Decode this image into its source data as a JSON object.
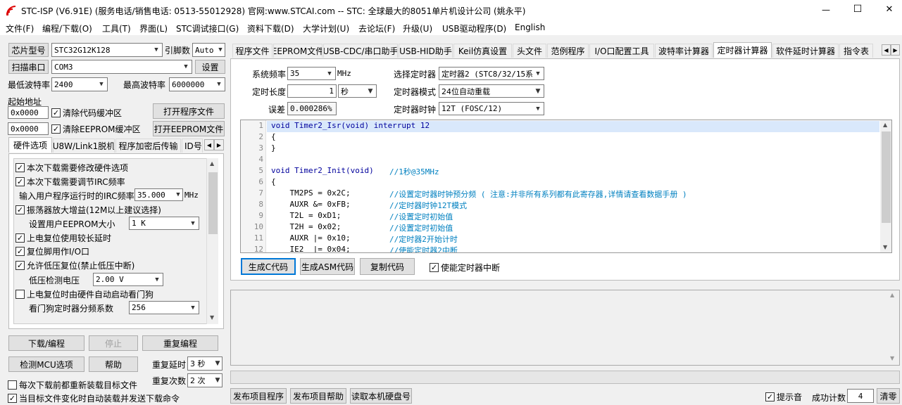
{
  "window": {
    "title": "STC-ISP (V6.91E) (服务电话/销售电话: 0513-55012928) 官网:www.STCAI.com  -- STC: 全球最大的8051单片机设计公司 (姚永平)",
    "minimize": "—",
    "maximize": "☐",
    "close": "✕"
  },
  "menu": [
    "文件(F)",
    "编程/下载(O)",
    "工具(T)",
    "界面(L)",
    "STC调试接口(G)",
    "资料下载(D)",
    "大学计划(U)",
    "去论坛(F)",
    "升级(U)",
    "USB驱动程序(D)",
    "English"
  ],
  "left": {
    "chip_label": "芯片型号",
    "chip_value": "STC32G12K128",
    "pin_label": "引脚数",
    "pin_value": "Auto",
    "scan_label": "扫描串口",
    "com_value": "COM3",
    "settings_label": "设置",
    "min_baud_label": "最低波特率",
    "min_baud_value": "2400",
    "max_baud_label": "最高波特率",
    "max_baud_value": "6000000",
    "start_addr_label": "起始地址",
    "addr1": "0x0000",
    "clear_code_label": "清除代码缓冲区",
    "open_prog_label": "打开程序文件",
    "addr2": "0x0000",
    "clear_eeprom_label": "清除EEPROM缓冲区",
    "open_eeprom_label": "打开EEPROM文件",
    "tabs": [
      "硬件选项",
      "U8W/Link1脱机",
      "程序加密后传输",
      "ID号"
    ],
    "options": {
      "opt1": "本次下载需要修改硬件选项",
      "opt2": "本次下载需要调节IRC频率",
      "irc_label": "输入用户程序运行时的IRC频率",
      "irc_value": "35.000",
      "irc_unit": "MHz",
      "opt3": "振荡器放大增益(12M以上建议选择)",
      "eeprom_size_label": "设置用户EEPROM大小",
      "eeprom_size_value": "1    K",
      "opt4": "上电复位使用较长延时",
      "opt5": "复位脚用作I/O口",
      "opt6": "允许低压复位(禁止低压中断)",
      "lv_label": "低压检测电压",
      "lv_value": "2.00 V",
      "opt7": "上电复位时由硬件自动启动看门狗",
      "wdt_label": "看门狗定时器分频系数",
      "wdt_value": "256"
    },
    "download_btn": "下载/编程",
    "stop_btn": "停止",
    "reprogram_btn": "重复编程",
    "check_mcu_btn": "检测MCU选项",
    "help_btn": "帮助",
    "retry_delay_label": "重复延时",
    "retry_delay_value": "3 秒",
    "retry_count_label": "重复次数",
    "retry_count_value": "2 次",
    "reload_label": "每次下载前都重新装载目标文件",
    "auto_send_label": "当目标文件变化时自动装载并发送下载命令"
  },
  "right_tabs": [
    "程序文件",
    "EEPROM文件",
    "USB-CDC/串口助手",
    "USB-HID助手",
    "Keil仿真设置",
    "头文件",
    "范例程序",
    "I/O口配置工具",
    "波特率计算器",
    "定时器计算器",
    "软件延时计算器",
    "指令表"
  ],
  "timer": {
    "sys_freq_label": "系统频率",
    "sys_freq_value": "35",
    "sys_freq_unit": "MHz",
    "select_timer_label": "选择定时器",
    "select_timer_value": "定时器2 (STC8/32/15系",
    "duration_label": "定时长度",
    "duration_value": "1",
    "duration_unit": "秒",
    "mode_label": "定时器模式",
    "mode_value": "24位自动重载",
    "error_label": "误差",
    "error_value": "0.000286%",
    "clock_label": "定时器时钟",
    "clock_value": "12T (FOSC/12)",
    "gen_c_btn": "生成C代码",
    "gen_asm_btn": "生成ASM代码",
    "copy_btn": "复制代码",
    "enable_int_label": "使能定时器中断"
  },
  "code": [
    {
      "n": "1",
      "code": "void Timer2_Isr(void) interrupt 12",
      "comment": ""
    },
    {
      "n": "2",
      "code": "{",
      "comment": ""
    },
    {
      "n": "3",
      "code": "}",
      "comment": ""
    },
    {
      "n": "4",
      "code": "",
      "comment": ""
    },
    {
      "n": "5",
      "code": "void Timer2_Init(void)      ",
      "comment": "//1秒@35MHz"
    },
    {
      "n": "6",
      "code": "{",
      "comment": ""
    },
    {
      "n": "7",
      "code": "    TM2PS = 0x2C;               ",
      "comment": "//设置定时器时钟预分频 ( 注意:并非所有系列都有此寄存器,详情请查看数据手册 )"
    },
    {
      "n": "8",
      "code": "    AUXR &= 0xFB;               ",
      "comment": "//定时器时钟12T模式"
    },
    {
      "n": "9",
      "code": "    T2L = 0xD1;                 ",
      "comment": "//设置定时初始值"
    },
    {
      "n": "10",
      "code": "    T2H = 0x02;                 ",
      "comment": "//设置定时初始值"
    },
    {
      "n": "11",
      "code": "    AUXR |= 0x10;               ",
      "comment": "//定时器2开始计时"
    },
    {
      "n": "12",
      "code": "    IE2  |= 0x04;               ",
      "comment": "//使能定时器2中断"
    }
  ],
  "bottom": {
    "publish_prog_btn": "发布项目程序",
    "publish_help_btn": "发布项目帮助",
    "read_disk_btn": "读取本机硬盘号",
    "sound_label": "提示音",
    "success_label": "成功计数",
    "success_value": "4",
    "clear_btn": "清零"
  }
}
